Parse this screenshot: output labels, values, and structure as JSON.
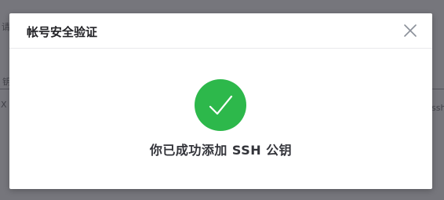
{
  "modal": {
    "title": "帐号安全验证",
    "message": "你已成功添加 SSH 公钥"
  },
  "background": {
    "fragment_1": "请",
    "fragment_2": "钥",
    "fragment_3": "X",
    "fragment_4": "ssh"
  },
  "icons": {
    "close": "close-icon",
    "success": "checkmark-icon"
  },
  "colors": {
    "success_green": "#2db84b",
    "overlay": "rgba(40,40,48,0.62)"
  }
}
